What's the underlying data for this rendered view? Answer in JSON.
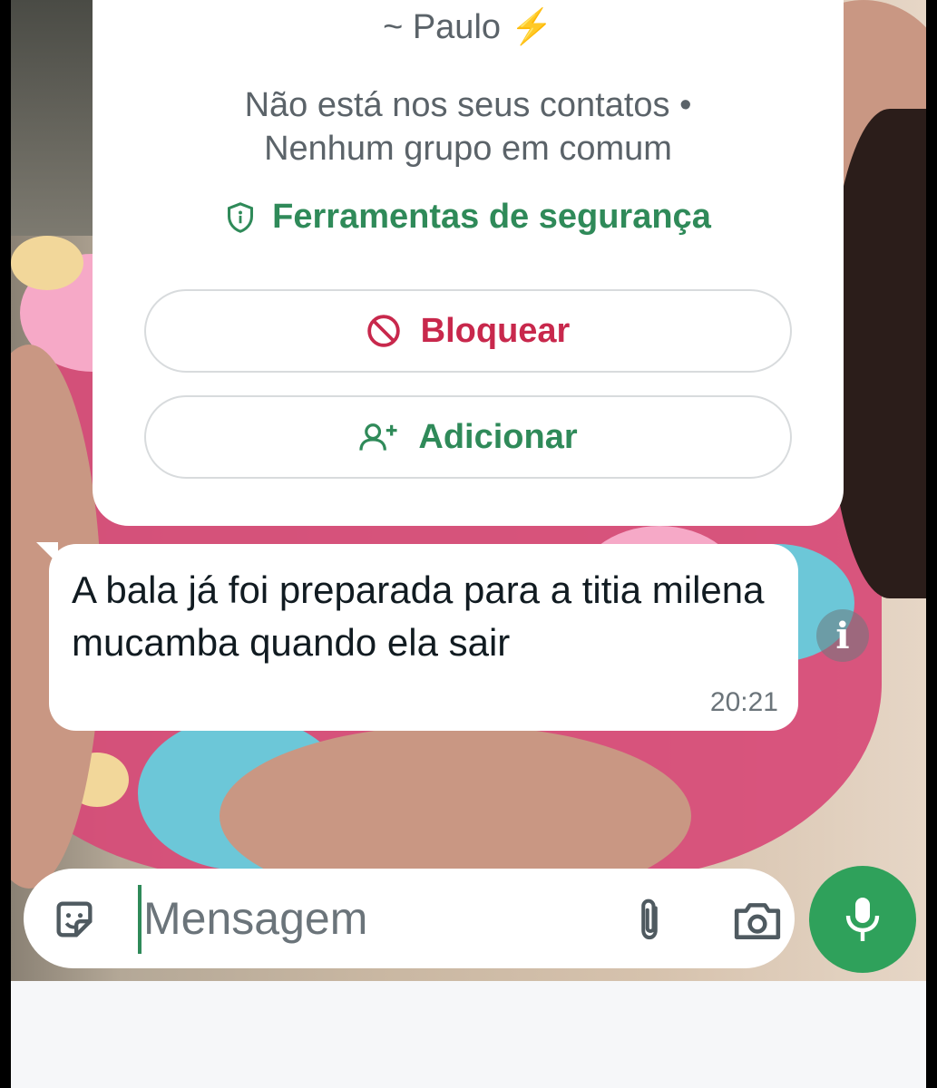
{
  "contact_card": {
    "name": "~ Paulo",
    "name_emoji": "⚡",
    "info_line1": "Não está nos seus contatos •",
    "info_line2": "Nenhum grupo em comum",
    "safety_tools_label": "Ferramentas de segurança",
    "block_label": "Bloquear",
    "add_label": "Adicionar"
  },
  "message": {
    "text": "A bala já foi preparada para a titia milena mucamba quando ela sair",
    "time": "20:21"
  },
  "composer": {
    "placeholder": "Mensagem"
  },
  "colors": {
    "accent_green": "#2f8a59",
    "block_red": "#c8284c",
    "mic_green": "#2fa15b"
  },
  "icons": [
    "shield-icon",
    "block-icon",
    "add-contact-icon",
    "info-icon",
    "sticker-icon",
    "paperclip-icon",
    "camera-icon",
    "microphone-icon"
  ]
}
